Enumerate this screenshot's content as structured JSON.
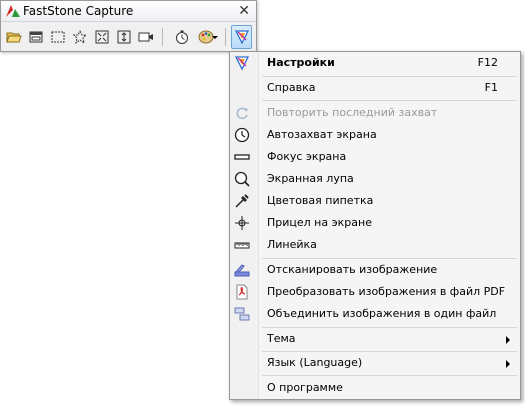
{
  "window": {
    "title": "FastStone Capture",
    "close_glyph": "✕"
  },
  "toolbar": {
    "tools": [
      {
        "name": "open-file-icon"
      },
      {
        "name": "capture-window-icon"
      },
      {
        "name": "capture-rectangle-icon"
      },
      {
        "name": "capture-freehand-icon"
      },
      {
        "name": "capture-fullscreen-icon"
      },
      {
        "name": "capture-scrolling-icon"
      },
      {
        "name": "screen-recorder-icon"
      },
      {
        "name": "delay-timer-icon"
      },
      {
        "name": "output-palette-icon"
      },
      {
        "name": "settings-menu-icon"
      }
    ]
  },
  "menu": {
    "items": [
      {
        "label": "Настройки",
        "shortcut": "F12",
        "icon": "settings-icon",
        "bold": true
      },
      {
        "label": "Справка",
        "shortcut": "F1",
        "icon": ""
      },
      {
        "label": "Повторить последний захват",
        "icon": "repeat-capture-icon",
        "disabled": true
      },
      {
        "label": "Автозахват экрана",
        "icon": "clock-icon"
      },
      {
        "label": "Фокус экрана",
        "icon": "screen-focus-icon"
      },
      {
        "label": "Экранная лупа",
        "icon": "magnifier-icon"
      },
      {
        "label": "Цветовая пипетка",
        "icon": "color-picker-icon"
      },
      {
        "label": "Прицел на экране",
        "icon": "crosshair-icon"
      },
      {
        "label": "Линейка",
        "icon": "ruler-icon"
      },
      {
        "label": "Отсканировать изображение",
        "icon": "scanner-icon"
      },
      {
        "label": "Преобразовать изображения в файл PDF",
        "icon": "pdf-icon"
      },
      {
        "label": "Объединить изображения в один файл",
        "icon": "combine-images-icon"
      },
      {
        "label": "Тема",
        "icon": "",
        "submenu": true
      },
      {
        "label": "Язык (Language)",
        "icon": "",
        "submenu": true
      },
      {
        "label": "О программе",
        "icon": ""
      }
    ]
  },
  "colors": {
    "menu_bg": "#f5f5f5",
    "accent_blue": "#3a7bd5",
    "disabled_text": "#9a9a9a"
  }
}
